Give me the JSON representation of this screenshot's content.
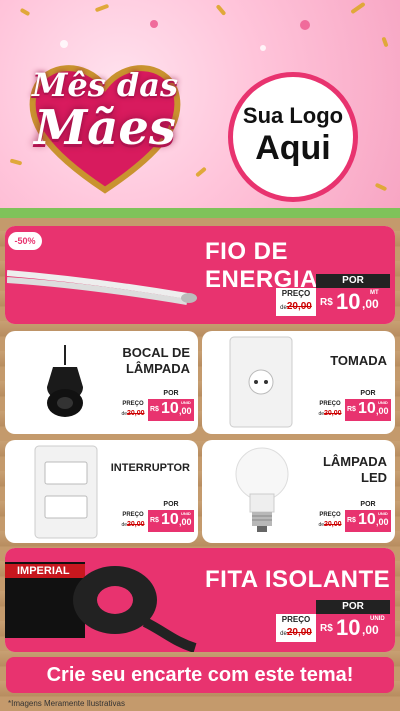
{
  "header": {
    "title_line1": "Mês das",
    "title_line2": "Mães",
    "logo_line1": "Sua Logo",
    "logo_line2": "Aqui"
  },
  "colors": {
    "accent": "#e8336f",
    "dark": "#222222",
    "wood": "#c49a6c"
  },
  "products": {
    "fio": {
      "title": "FIO DE ENERGIA",
      "discount": "-50%",
      "por": "POR",
      "preco_label": "PREÇO",
      "de": "de",
      "old_price": "20,00",
      "currency": "R$",
      "price_int": "10",
      "price_dec": ",00",
      "unit": "MT",
      "icon": "wire-icon"
    },
    "bocal": {
      "title_l1": "BOCAL DE",
      "title_l2": "LÂMPADA",
      "por": "POR",
      "preco_label": "PREÇO",
      "de": "de",
      "old_price": "20,00",
      "currency": "R$",
      "price_int": "10",
      "price_dec": ",00",
      "unit": "UNID",
      "icon": "lamp-socket-icon"
    },
    "tomada": {
      "title": "TOMADA",
      "por": "POR",
      "preco_label": "PREÇO",
      "de": "de",
      "old_price": "20,00",
      "currency": "R$",
      "price_int": "10",
      "price_dec": ",00",
      "unit": "UNID",
      "icon": "outlet-icon"
    },
    "interruptor": {
      "title": "INTERRUPTOR",
      "por": "POR",
      "preco_label": "PREÇO",
      "de": "de",
      "old_price": "20,00",
      "currency": "R$",
      "price_int": "10",
      "price_dec": ",00",
      "unit": "UNID",
      "icon": "switch-icon"
    },
    "lampada": {
      "title_l1": "LÂMPADA",
      "title_l2": "LED",
      "por": "POR",
      "preco_label": "PREÇO",
      "de": "de",
      "old_price": "20,00",
      "currency": "R$",
      "price_int": "10",
      "price_dec": ",00",
      "unit": "UNID",
      "icon": "led-bulb-icon"
    },
    "fita": {
      "title": "FITA ISOLANTE",
      "brand": "IMPERIAL",
      "por": "POR",
      "preco_label": "PREÇO",
      "de": "de",
      "old_price": "20,00",
      "currency": "R$",
      "price_int": "10",
      "price_dec": ",00",
      "unit": "UNID",
      "icon": "tape-icon"
    }
  },
  "cta": "Crie seu encarte com este tema!",
  "footer_note": "*Imagens Meramente Ilustrativas"
}
